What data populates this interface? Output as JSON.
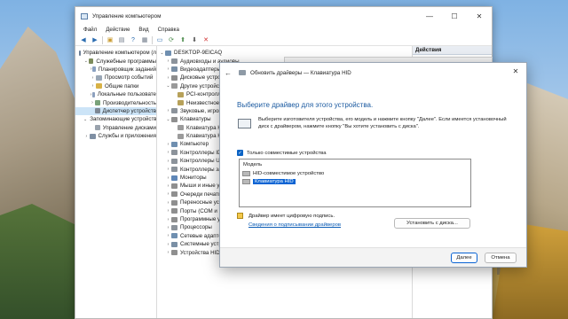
{
  "main_window": {
    "title": "Управление компьютером",
    "controls": {
      "minimize": "—",
      "maximize": "☐",
      "close": "✕"
    },
    "menu": [
      "Файл",
      "Действие",
      "Вид",
      "Справка"
    ],
    "toolbar_icons": [
      "back-arrow-icon",
      "forward-arrow-icon",
      "up-folder-icon",
      "properties-icon",
      "help-icon",
      "console-icon",
      "monitor-icon",
      "scan-icon",
      "update-driver-icon",
      "disable-icon",
      "uninstall-icon"
    ]
  },
  "left_tree": [
    {
      "label": "Управление компьютером (л",
      "chev": "",
      "indent": 0,
      "color": "#6d7f95"
    },
    {
      "label": "Служебные программы",
      "chev": "⌄",
      "indent": 1,
      "color": "#7d8c5c"
    },
    {
      "label": "Планировщик заданий",
      "chev": "›",
      "indent": 2,
      "color": "#8aa1c2"
    },
    {
      "label": "Просмотр событий",
      "chev": "›",
      "indent": 2,
      "color": "#9aa7b6"
    },
    {
      "label": "Общие папки",
      "chev": "›",
      "indent": 2,
      "color": "#d8b246"
    },
    {
      "label": "Локальные пользовате",
      "chev": "›",
      "indent": 2,
      "color": "#8ca0be"
    },
    {
      "label": "Производительность",
      "chev": "›",
      "indent": 2,
      "color": "#79a27a"
    },
    {
      "label": "Диспетчер устройств",
      "chev": "",
      "indent": 2,
      "color": "#7e8894",
      "selected": true
    },
    {
      "label": "Запоминающие устройств",
      "chev": "⌄",
      "indent": 1,
      "color": "#8f8f8f"
    },
    {
      "label": "Управление дисками",
      "chev": "",
      "indent": 2,
      "color": "#9aa3ad"
    },
    {
      "label": "Службы и приложения",
      "chev": "›",
      "indent": 1,
      "color": "#7f8fa3"
    }
  ],
  "device_tree": [
    {
      "label": "DESKTOP-9EICAQ",
      "chev": "⌄",
      "indent": 0,
      "color": "#6f8fb0"
    },
    {
      "label": "Аудиовходы и аудиовы",
      "chev": "›",
      "indent": 1,
      "color": "#8c939b"
    },
    {
      "label": "Видеоадаптеры",
      "chev": "›",
      "indent": 1,
      "color": "#7a8fa5"
    },
    {
      "label": "Дисковые устройства",
      "chev": "›",
      "indent": 1,
      "color": "#8d8d8d"
    },
    {
      "label": "Другие устройства",
      "chev": "⌄",
      "indent": 1,
      "color": "#9a9a9a"
    },
    {
      "label": "PCI-контроллер",
      "chev": "",
      "indent": 2,
      "color": "#b7a15a"
    },
    {
      "label": "Неизвестное устро",
      "chev": "",
      "indent": 2,
      "color": "#b7a15a"
    },
    {
      "label": "Звуковые, игровые и",
      "chev": "›",
      "indent": 1,
      "color": "#8c939b"
    },
    {
      "label": "Клавиатуры",
      "chev": "⌄",
      "indent": 1,
      "color": "#8f8f8f"
    },
    {
      "label": "Клавиатура HID",
      "chev": "",
      "indent": 2,
      "color": "#9b9b9b"
    },
    {
      "label": "Клавиатура HID",
      "chev": "",
      "indent": 2,
      "color": "#9b9b9b"
    },
    {
      "label": "Компьютер",
      "chev": "›",
      "indent": 1,
      "color": "#6f8fb0"
    },
    {
      "label": "Контроллеры IDE AT",
      "chev": "›",
      "indent": 1,
      "color": "#8c939b"
    },
    {
      "label": "Контроллеры USB",
      "chev": "›",
      "indent": 1,
      "color": "#8c939b"
    },
    {
      "label": "Контроллеры запом",
      "chev": "›",
      "indent": 1,
      "color": "#8c939b"
    },
    {
      "label": "Мониторы",
      "chev": "›",
      "indent": 1,
      "color": "#5f87b8"
    },
    {
      "label": "Мыши и иные указ",
      "chev": "›",
      "indent": 1,
      "color": "#8f8f8f"
    },
    {
      "label": "Очереди печати",
      "chev": "›",
      "indent": 1,
      "color": "#8f8f8f"
    },
    {
      "label": "Переносные устр",
      "chev": "›",
      "indent": 1,
      "color": "#8f8f8f"
    },
    {
      "label": "Порты (COM и LPT",
      "chev": "›",
      "indent": 1,
      "color": "#8f8f8f"
    },
    {
      "label": "Программные уст",
      "chev": "›",
      "indent": 1,
      "color": "#8f8f8f"
    },
    {
      "label": "Процессоры",
      "chev": "›",
      "indent": 1,
      "color": "#8c939b"
    },
    {
      "label": "Сетевые адаптер",
      "chev": "›",
      "indent": 1,
      "color": "#6f8fb0"
    },
    {
      "label": "Системные устро",
      "chev": "›",
      "indent": 1,
      "color": "#7a8fa5"
    },
    {
      "label": "Устройства HID",
      "chev": "›",
      "indent": 1,
      "color": "#8f8f8f"
    }
  ],
  "actions_panel": {
    "header": "Действия"
  },
  "dialog": {
    "title": "Обновить драйверы — Клавиатура HID",
    "close": "✕",
    "back": "←",
    "heading": "Выберите драйвер для этого устройства.",
    "info": "Выберите изготовителя устройства, его модель и нажмите кнопку \"Далее\". Если имеется установочный диск с драйвером, нажмите кнопку \"Вы хотите установить с диска\".",
    "compatible_label": "Только совместимые устройства",
    "compatible_check": "✓",
    "list_header": "Модель",
    "models": [
      {
        "label": "HID-совместимое устройство",
        "selected": false
      },
      {
        "label": "Клавиатура HID",
        "selected": true
      }
    ],
    "signed_text": "Драйвер имеет цифровую подпись.",
    "signing_link": "Сведения о подписывании драйверов",
    "disk_button": "Установить с диска...",
    "next_button": "Далее",
    "cancel_button": "Отмена"
  }
}
